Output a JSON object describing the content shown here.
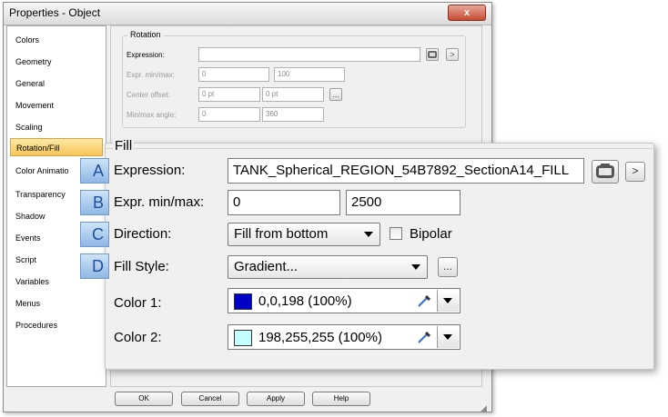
{
  "window": {
    "title": "Properties - Object",
    "close_label": "x"
  },
  "sidebar": {
    "items": [
      {
        "label": "Colors"
      },
      {
        "label": "Geometry"
      },
      {
        "label": "General"
      },
      {
        "label": "Movement"
      },
      {
        "label": "Scaling"
      },
      {
        "label": "Rotation/Fill",
        "selected": true
      },
      {
        "label": "Color Animatio"
      },
      {
        "label": "Transparency"
      },
      {
        "label": "Shadow"
      },
      {
        "label": "Events"
      },
      {
        "label": "Script"
      },
      {
        "label": "Variables"
      },
      {
        "label": "Menus"
      },
      {
        "label": "Procedures"
      }
    ]
  },
  "rotation": {
    "legend": "Rotation",
    "expression_label": "Expression:",
    "expression_value": "",
    "minmax_label": "Expr. min/max:",
    "min_value": "0",
    "max_value": "100",
    "center_label": "Center offset:",
    "center_x": "0 pt",
    "center_y": "0 pt",
    "angle_label": "Min/max angle:",
    "angle_min": "0",
    "angle_max": "360",
    "more_label": ">",
    "ellipsis": "..."
  },
  "fill": {
    "legend": "Fill",
    "badges": [
      "A",
      "B",
      "C",
      "D"
    ],
    "expression_label": "Expression:",
    "expression_value": "TANK_Spherical_REGION_54B7892_SectionA14_FILL",
    "more_label": ">",
    "minmax_label": "Expr. min/max:",
    "min_value": "0",
    "max_value": "2500",
    "direction_label": "Direction:",
    "direction_value": "Fill from bottom",
    "bipolar_label": "Bipolar",
    "bipolar_checked": false,
    "style_label": "Fill Style:",
    "style_value": "Gradient...",
    "style_more": "...",
    "color1_label": "Color 1:",
    "color1_value": "0,0,198 (100%)",
    "color1_hex": "#0000c6",
    "color2_label": "Color 2:",
    "color2_value": "198,255,255 (100%)",
    "color2_hex": "#c6ffff"
  },
  "buttons": {
    "ok": "OK",
    "cancel": "Cancel",
    "apply": "Apply",
    "help": "Help"
  }
}
